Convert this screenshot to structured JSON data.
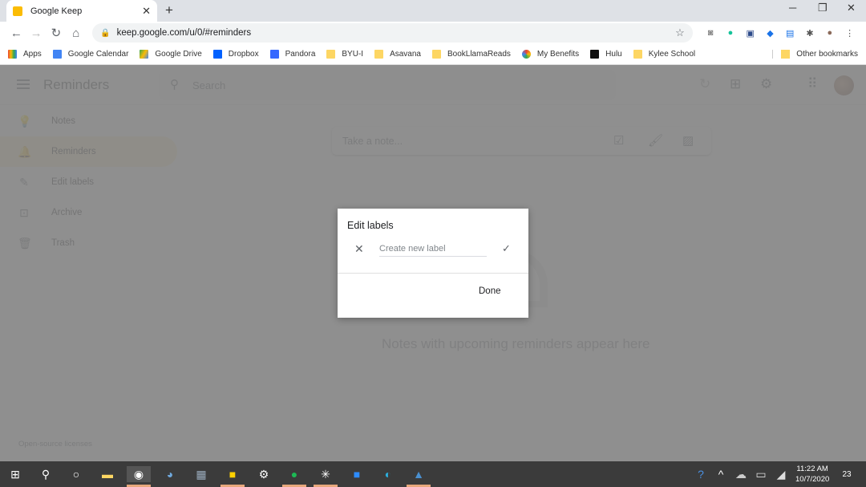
{
  "browser": {
    "tab_title": "Google Keep",
    "new_tab": "+",
    "url": "keep.google.com/u/0/#reminders",
    "window_controls": {
      "minimize": "─",
      "restore": "❐",
      "close": "✕"
    },
    "bookmarks": [
      {
        "label": "Apps",
        "icon": "apps-grid-icon"
      },
      {
        "label": "Google Calendar",
        "icon": "calendar-icon"
      },
      {
        "label": "Google Drive",
        "icon": "drive-icon"
      },
      {
        "label": "Dropbox",
        "icon": "dropbox-icon"
      },
      {
        "label": "Pandora",
        "icon": "pandora-icon"
      },
      {
        "label": "BYU-I",
        "icon": "folder-icon"
      },
      {
        "label": "Asavana",
        "icon": "folder-icon"
      },
      {
        "label": "BookLlamaReads",
        "icon": "folder-icon"
      },
      {
        "label": "My Benefits",
        "icon": "benefits-icon"
      },
      {
        "label": "Hulu",
        "icon": "hulu-icon"
      },
      {
        "label": "Kylee School",
        "icon": "folder-icon"
      }
    ],
    "other_bookmarks": "Other bookmarks"
  },
  "keep": {
    "header_title": "Reminders",
    "search_placeholder": "Search",
    "sidebar": [
      {
        "label": "Notes",
        "icon": "💡"
      },
      {
        "label": "Reminders",
        "icon": "🔔"
      },
      {
        "label": "Edit labels",
        "icon": "✎"
      },
      {
        "label": "Archive",
        "icon": "⊡"
      },
      {
        "label": "Trash",
        "icon": "🗑"
      }
    ],
    "take_note_placeholder": "Take a note...",
    "empty_message": "Notes with upcoming reminders appear here",
    "licenses": "Open-source licenses"
  },
  "dialog": {
    "title": "Edit labels",
    "input_placeholder": "Create new label",
    "done_label": "Done"
  },
  "taskbar": {
    "time": "11:22 AM",
    "date": "10/7/2020",
    "notification_count": "23"
  }
}
